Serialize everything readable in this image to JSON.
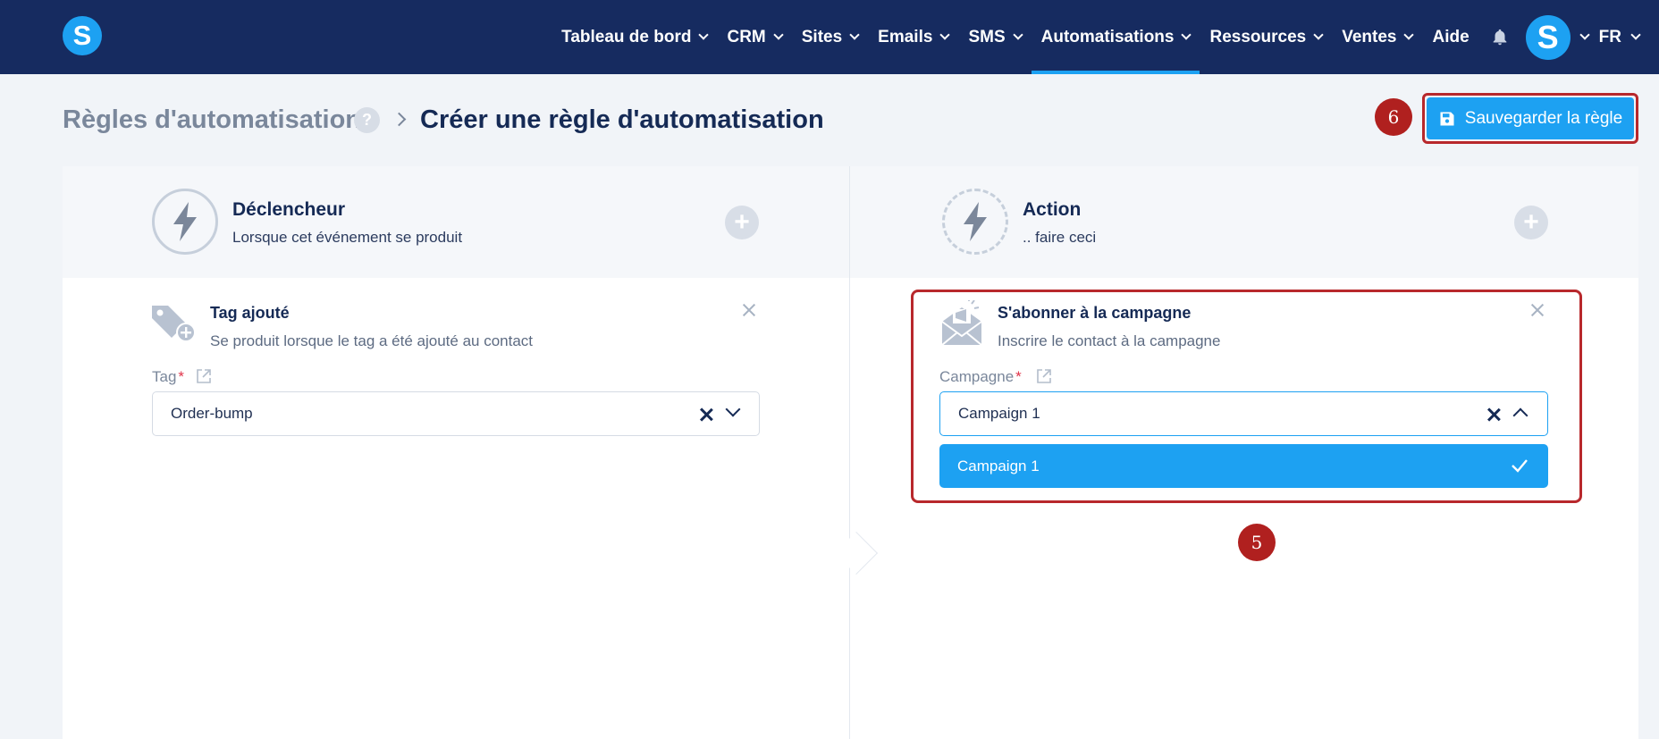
{
  "app": {
    "logo_letter": "S",
    "avatar_letter": "S"
  },
  "nav": {
    "items": [
      {
        "label": "Tableau de bord",
        "dropdown": true,
        "active": false
      },
      {
        "label": "CRM",
        "dropdown": true,
        "active": false
      },
      {
        "label": "Sites",
        "dropdown": true,
        "active": false
      },
      {
        "label": "Emails",
        "dropdown": true,
        "active": false
      },
      {
        "label": "SMS",
        "dropdown": true,
        "active": false
      },
      {
        "label": "Automatisations",
        "dropdown": true,
        "active": true
      },
      {
        "label": "Ressources",
        "dropdown": true,
        "active": false
      },
      {
        "label": "Ventes",
        "dropdown": true,
        "active": false
      },
      {
        "label": "Aide",
        "dropdown": false,
        "active": false
      }
    ],
    "language": "FR"
  },
  "breadcrumb": {
    "root": "Règles d'automatisation",
    "help": "?",
    "current": "Créer une règle d'automatisation"
  },
  "save_button": {
    "label": "Sauvegarder la règle"
  },
  "annotations": {
    "badge_save": "6",
    "badge_action": "5"
  },
  "trigger": {
    "title": "Déclencheur",
    "subtitle": "Lorsque cet événement se produit",
    "item": {
      "title": "Tag ajouté",
      "description": "Se produit lorsque le tag a été ajouté au contact",
      "field_label": "Tag",
      "required_mark": "*",
      "value": "Order-bump"
    }
  },
  "action": {
    "title": "Action",
    "subtitle": ".. faire ceci",
    "item": {
      "title": "S'abonner à la campagne",
      "description": "Inscrire le contact à la campagne",
      "field_label": "Campagne",
      "required_mark": "*",
      "value": "Campaign 1",
      "options": [
        "Campaign 1"
      ],
      "selected_option": "Campaign 1"
    }
  },
  "colors": {
    "nav_bg": "#162b60",
    "accent": "#1da1f2",
    "annotation_red": "#b0201f",
    "page_bg": "#f1f4f8"
  },
  "icons": {
    "logo": "brand-logo",
    "bell": "bell-icon",
    "save": "floppy-disk-icon",
    "trigger": "lightning-bolt-icon",
    "action": "lightning-bolt-refresh-icon",
    "tag": "tag-plus-icon",
    "campaign": "envelope-megaphone-icon",
    "external": "external-link-icon",
    "check": "checkmark-icon"
  }
}
